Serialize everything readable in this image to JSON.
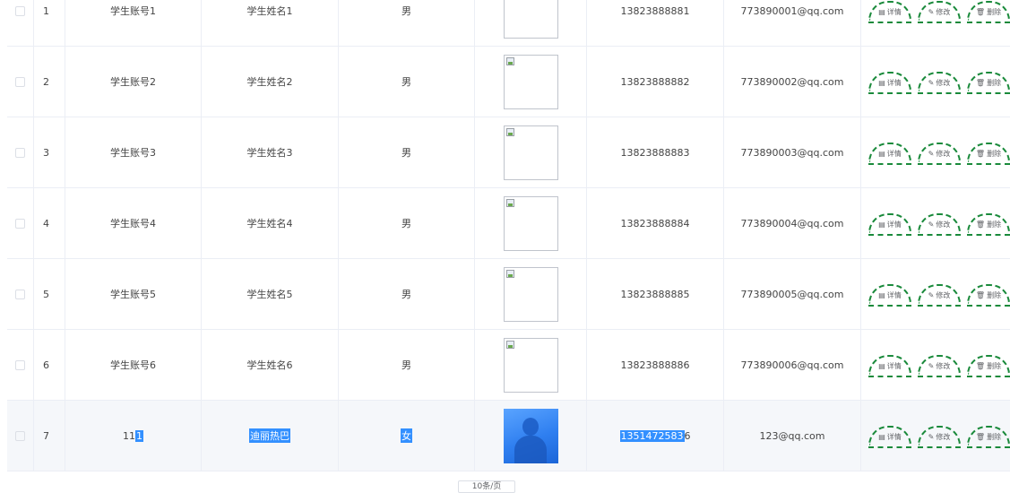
{
  "table": {
    "rows": [
      {
        "index": "1",
        "account": "学生账号1",
        "name": "学生姓名1",
        "sex": "男",
        "image": "broken",
        "phone": "13823888881",
        "email": "773890001@qq.com"
      },
      {
        "index": "2",
        "account": "学生账号2",
        "name": "学生姓名2",
        "sex": "男",
        "image": "broken",
        "phone": "13823888882",
        "email": "773890002@qq.com"
      },
      {
        "index": "3",
        "account": "学生账号3",
        "name": "学生姓名3",
        "sex": "男",
        "image": "broken",
        "phone": "13823888883",
        "email": "773890003@qq.com"
      },
      {
        "index": "4",
        "account": "学生账号4",
        "name": "学生姓名4",
        "sex": "男",
        "image": "broken",
        "phone": "13823888884",
        "email": "773890004@qq.com"
      },
      {
        "index": "5",
        "account": "学生账号5",
        "name": "学生姓名5",
        "sex": "男",
        "image": "broken",
        "phone": "13823888885",
        "email": "773890005@qq.com"
      },
      {
        "index": "6",
        "account": "学生账号6",
        "name": "学生姓名6",
        "sex": "男",
        "image": "broken",
        "phone": "13823888886",
        "email": "773890006@qq.com"
      },
      {
        "index": "7",
        "account_sel_a": "11",
        "account_sel_b": "1",
        "name": "迪丽热巴",
        "sex": "女",
        "image": "photo",
        "phone_sel": "1351472583",
        "phone_rest": "6",
        "email": "123@qq.com"
      }
    ],
    "actions": {
      "detail": {
        "label": "详情",
        "icon": "document-icon"
      },
      "edit": {
        "label": "修改",
        "icon": "pencil-icon"
      },
      "delete": {
        "label": "删除",
        "icon": "trash-icon"
      }
    }
  },
  "pagination": {
    "button_label": "10条/页"
  },
  "colors": {
    "action_border": "#1a8a3b",
    "selection": "#3390ff",
    "highlight_row": "#f5f7fa"
  }
}
